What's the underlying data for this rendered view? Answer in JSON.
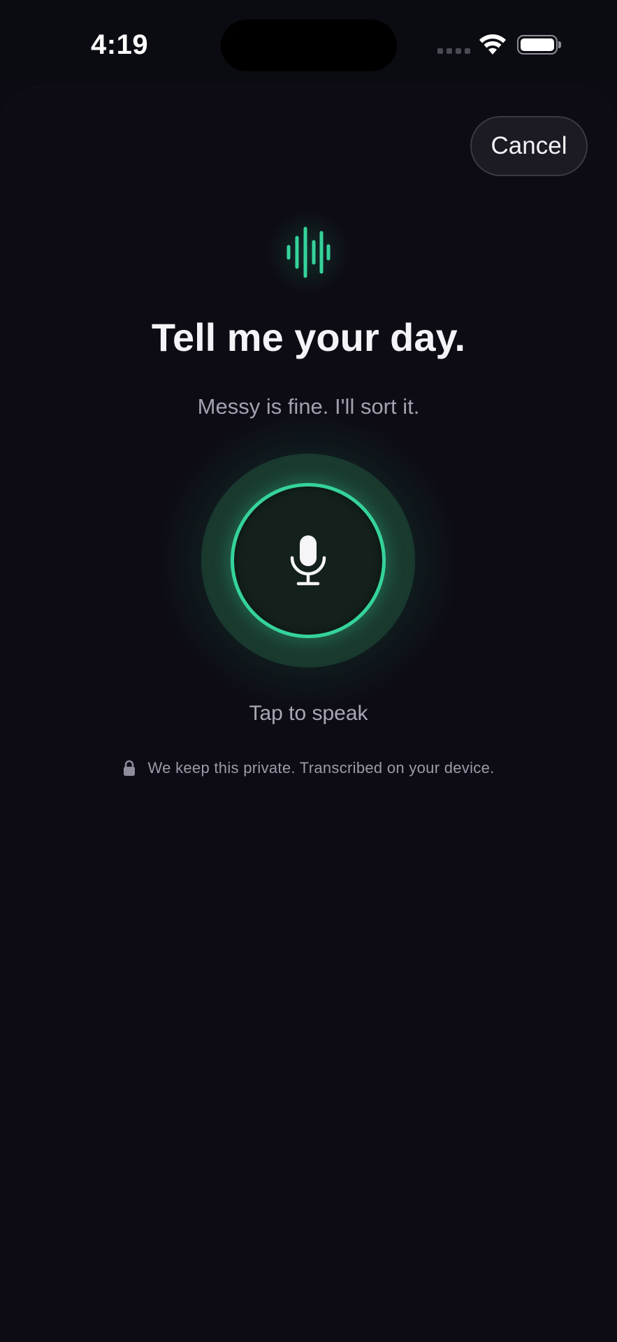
{
  "status_bar": {
    "time": "4:19",
    "icons": [
      "cellular-signal-icon",
      "wifi-icon",
      "battery-icon"
    ]
  },
  "sheet": {
    "cancel_label": "Cancel",
    "header_icon": "voice-waveform-icon",
    "title": "Tell me your day.",
    "subtitle": "Messy is fine. I'll sort it.",
    "record_button_icon": "microphone-icon",
    "record_hint": "Tap to speak",
    "privacy_icon": "lock-icon",
    "privacy_note": "We keep this private. Transcribed on your device."
  },
  "colors": {
    "background": "#0c0b13",
    "accent": "#35d39a",
    "text_primary": "#f4f4f8",
    "text_secondary": "#a3a1b0"
  }
}
